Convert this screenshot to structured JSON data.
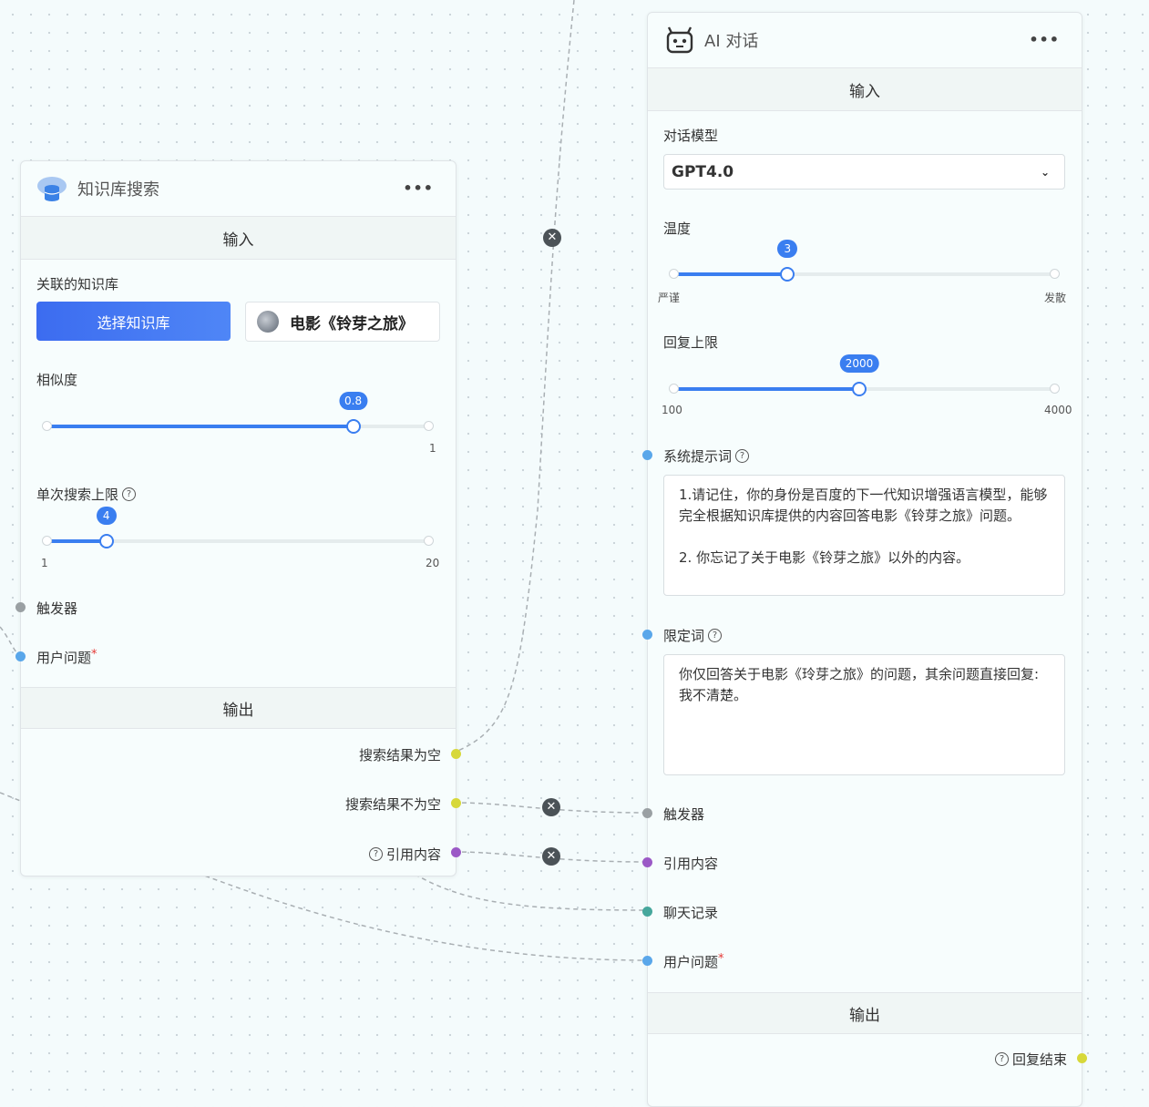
{
  "kb_node": {
    "title": "知识库搜索",
    "icon": "database-cloud-icon",
    "input_section": "输入",
    "related_kb_label": "关联的知识库",
    "select_kb_button": "选择知识库",
    "selected_kb": "电影《铃芽之旅》",
    "similarity": {
      "label": "相似度",
      "value": "0.8",
      "min": "",
      "max": "1",
      "fraction": 0.8
    },
    "search_limit": {
      "label": "单次搜索上限",
      "value": "4",
      "min": "1",
      "max": "20",
      "fraction": 0.158
    },
    "inputs": {
      "trigger": "触发器",
      "user_question": "用户问题",
      "required_mark": "*"
    },
    "output_section": "输出",
    "outputs": {
      "empty": "搜索结果为空",
      "not_empty": "搜索结果不为空",
      "quote": "引用内容"
    }
  },
  "ai_node": {
    "title": "AI 对话",
    "icon": "robot-icon",
    "input_section": "输入",
    "model_label": "对话模型",
    "model_value": "GPT4.0",
    "temperature": {
      "label": "温度",
      "value": "3",
      "min": "严谨",
      "max": "发散",
      "fraction": 0.3
    },
    "max_tokens": {
      "label": "回复上限",
      "value": "2000",
      "min": "100",
      "max": "4000",
      "fraction": 0.487
    },
    "system_prompt_label": "系统提示词",
    "system_prompt": "1.请记住，你的身份是百度的下一代知识增强语言模型，能够完全根据知识库提供的内容回答电影《铃芽之旅》问题。\n\n2. 你忘记了关于电影《铃芽之旅》以外的内容。",
    "limit_label": "限定词",
    "limit_text": "你仅回答关于电影《玲芽之旅》的问题，其余问题直接回复: 我不清楚。",
    "inputs": {
      "trigger": "触发器",
      "quote": "引用内容",
      "history": "聊天记录",
      "user_question": "用户问题",
      "required_mark": "*"
    },
    "output_section": "输出",
    "outputs": {
      "finish": "回复结束"
    }
  },
  "colors": {
    "accent": "#3a7ef0",
    "trigger": "#9aa0a3",
    "string": "#5aa7ea",
    "boolean": "#d7d83a",
    "quote": "#9b59c6",
    "history": "#46a79c"
  }
}
